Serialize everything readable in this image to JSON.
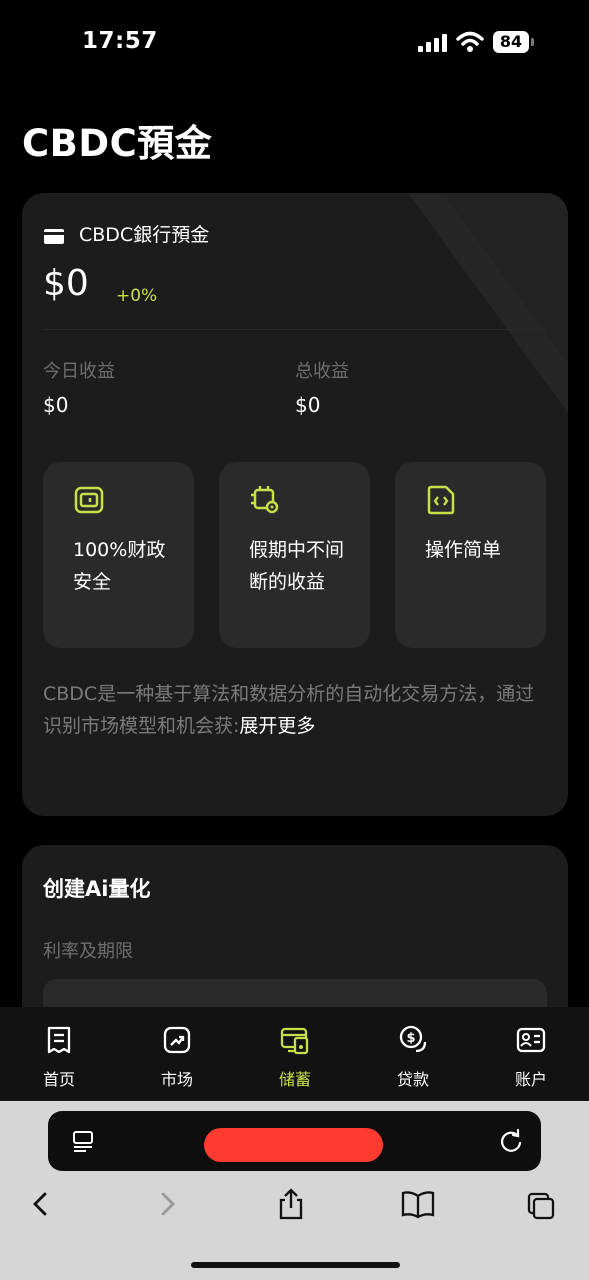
{
  "status_bar": {
    "time": "17:57",
    "battery": "84"
  },
  "page": {
    "title": "CBDC預金"
  },
  "account_card": {
    "label": "CBDC銀行預金",
    "balance": "$0",
    "change": "+0%",
    "stats": [
      {
        "label": "今日收益",
        "value": "$0"
      },
      {
        "label": "总收益",
        "value": "$0"
      }
    ],
    "features": [
      {
        "icon": "wallet-shield-icon",
        "text": "100%财政安全"
      },
      {
        "icon": "chip-gear-icon",
        "text": "假期中不间断的收益"
      },
      {
        "icon": "code-file-icon",
        "text": "操作简单"
      }
    ],
    "description": "CBDC是一种基于算法和数据分析的自动化交易方法，通过识别市场模型和机会获:",
    "expand_label": "展开更多"
  },
  "create_card": {
    "title": "创建Ai量化",
    "rate_label": "利率及期限"
  },
  "tabbar": {
    "items": [
      {
        "icon": "home-doc-icon",
        "label": "首页"
      },
      {
        "icon": "market-chart-icon",
        "label": "市场"
      },
      {
        "icon": "savings-icon",
        "label": "储蓄",
        "active": true
      },
      {
        "icon": "loan-coin-icon",
        "label": "贷款"
      },
      {
        "icon": "account-card-icon",
        "label": "账户"
      }
    ]
  },
  "colors": {
    "accent": "#c7e04a",
    "card": "#1c1c1c",
    "tile": "#2a2a2a",
    "redaction": "#ff3b30"
  }
}
